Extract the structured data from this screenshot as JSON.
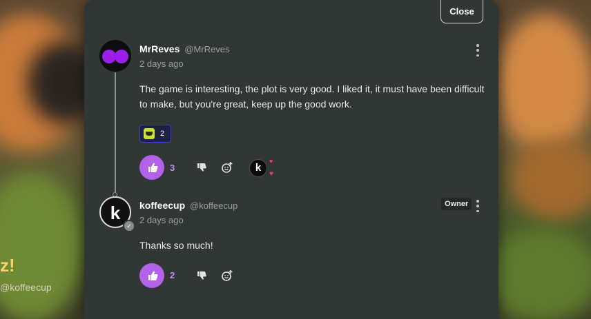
{
  "background": {
    "title_fragment": "z!",
    "handle": "@koffeecup"
  },
  "close_label": "Close",
  "comments": [
    {
      "author": "MrReves",
      "handle": "@MrReves",
      "time": "2 days ago",
      "body": "The game is interesting, the plot is very good. I liked it, it must have been difficult to make, but you're great, keep up the good work.",
      "reaction": {
        "icon": "green-face-emoji",
        "count": "2"
      },
      "likes": "3",
      "liked_by_owner": true
    },
    {
      "author": "koffeecup",
      "handle": "@koffeecup",
      "time": "2 days ago",
      "badge": "Owner",
      "body": "Thanks so much!",
      "likes": "2"
    }
  ],
  "colors": {
    "panel": "#313735",
    "accent": "#b461e9",
    "reaction_border": "#3a3fd6"
  }
}
